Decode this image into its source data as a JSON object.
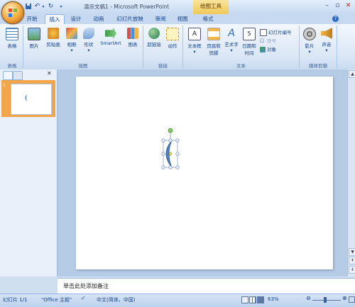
{
  "window": {
    "title": "演示文稿1 - Microsoft PowerPoint",
    "contextual_tab": "绘图工具",
    "qat": [
      "save-icon",
      "undo-icon",
      "redo-icon",
      "dropdown-icon"
    ]
  },
  "tabs": [
    {
      "label": "开始",
      "active": false
    },
    {
      "label": "插入",
      "active": true
    },
    {
      "label": "设计",
      "active": false
    },
    {
      "label": "动画",
      "active": false
    },
    {
      "label": "幻灯片放映",
      "active": false
    },
    {
      "label": "审阅",
      "active": false
    },
    {
      "label": "视图",
      "active": false
    },
    {
      "label": "格式",
      "active": false
    }
  ],
  "ribbon": {
    "groups": {
      "tables": "表格",
      "illustrations": "插图",
      "links": "链接",
      "text": "文本",
      "media": "媒体剪辑"
    },
    "buttons": {
      "table": "表格",
      "picture": "图片",
      "clipart": "剪贴画",
      "album": "相册",
      "shapes": "形状",
      "smartart": "SmartArt",
      "chart": "图表",
      "hyperlink": "超链接",
      "action": "动作",
      "textbox": "文本框",
      "header_footer_1": "页眉和",
      "header_footer_2": "页脚",
      "wordart": "艺术字",
      "datetime_1": "日期和",
      "datetime_2": "时间",
      "slide_number": "幻灯片编号",
      "symbol": "符号",
      "object": "对象",
      "movie": "影片",
      "sound": "声音"
    }
  },
  "slides_panel": {
    "thumb_number": "1"
  },
  "notes": {
    "placeholder": "单击此处添加备注"
  },
  "status": {
    "slide": "幻灯片 1/1",
    "theme": "\"Office 主题\"",
    "language": "中文(简体，中国)",
    "zoom": "63%"
  },
  "colors": {
    "accent": "#15428b",
    "shape_fill": "#4f81bd",
    "selected_thumb": "#f3a549"
  }
}
